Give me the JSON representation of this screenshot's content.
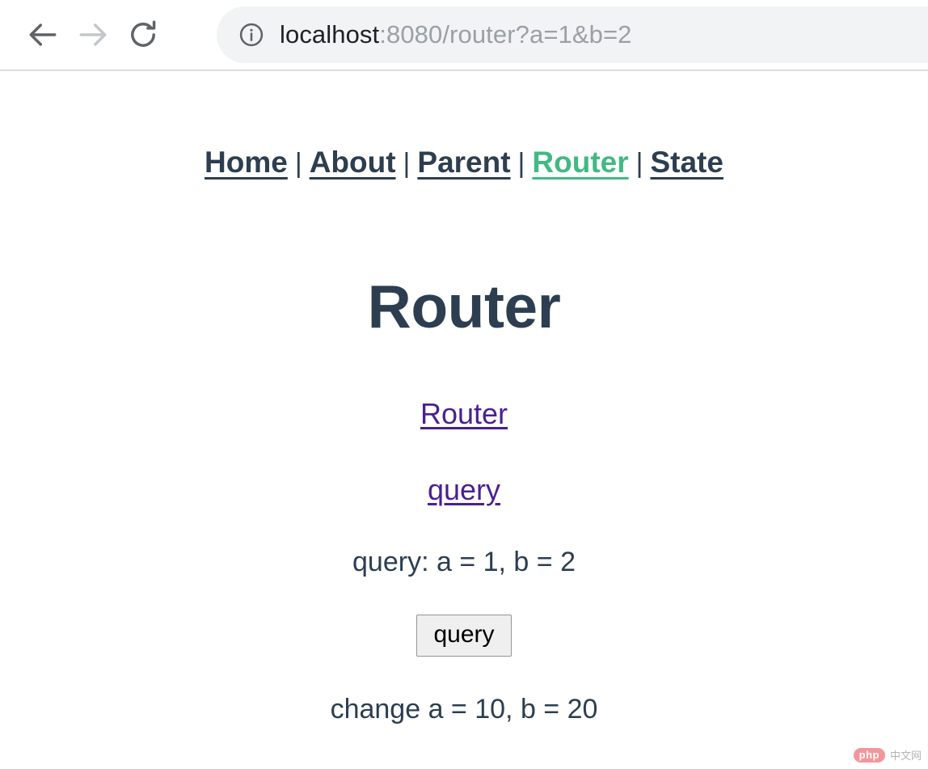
{
  "browser": {
    "back_label": "Back",
    "forward_label": "Forward",
    "reload_label": "Reload",
    "site_info_label": "Site information",
    "url_full": "localhost:8080/router?a=1&b=2",
    "url_host": "localhost",
    "url_rest": ":8080/router?a=1&b=2"
  },
  "nav": {
    "separator": "|",
    "links": [
      {
        "label": "Home",
        "active": false
      },
      {
        "label": "About",
        "active": false
      },
      {
        "label": "Parent",
        "active": false
      },
      {
        "label": "Router",
        "active": true
      },
      {
        "label": "State",
        "active": false
      }
    ]
  },
  "main": {
    "title": "Router",
    "router_link": "Router",
    "query_link": "query",
    "query_info": "query: a = 1, b = 2",
    "query_button": "query",
    "change_info": "change a = 10, b = 20"
  },
  "watermark": {
    "badge": "php",
    "text": "中文网"
  },
  "colors": {
    "accent_green": "#42b983",
    "text_dark": "#2c3e50",
    "link_purple": "#4b1f91",
    "omnibox_bg": "#f1f3f4",
    "url_muted": "#9aa0a6"
  }
}
